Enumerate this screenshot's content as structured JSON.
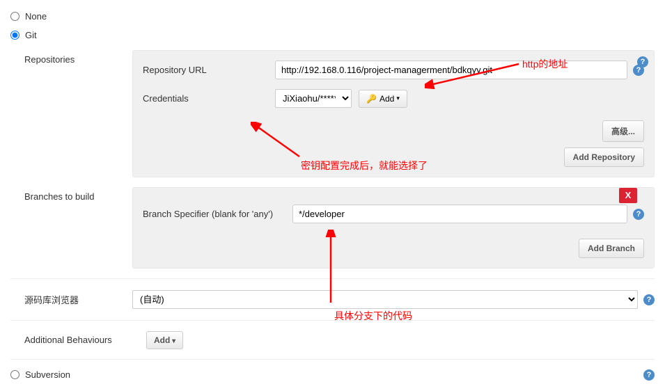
{
  "scm_options": {
    "none": "None",
    "git": "Git",
    "subversion": "Subversion",
    "selected": "git"
  },
  "repositories": {
    "label": "Repositories",
    "repo_url_label": "Repository URL",
    "repo_url_value": "http://192.168.0.116/project-managerment/bdkqyy.git",
    "credentials_label": "Credentials",
    "credentials_selected": "JiXiaohu/******",
    "add_button": "Add",
    "advanced_button": "高级...",
    "add_repo_button": "Add Repository"
  },
  "branches": {
    "label": "Branches to build",
    "specifier_label": "Branch Specifier (blank for 'any')",
    "specifier_value": "*/developer",
    "add_branch_button": "Add Branch",
    "close_x": "X"
  },
  "repo_browser": {
    "label": "源码库浏览器",
    "selected": "(自动)"
  },
  "additional_behaviours": {
    "label": "Additional Behaviours",
    "add_button": "Add"
  },
  "annotations": {
    "http_addr": "http的地址",
    "credentials_note": "密钥配置完成后，就能选择了",
    "branch_note": "具体分支下的代码"
  }
}
